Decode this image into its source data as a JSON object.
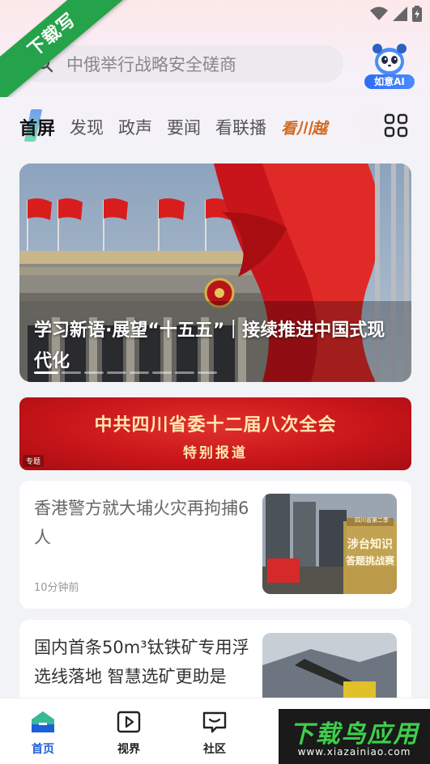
{
  "watermark": {
    "ribbon": "下载写",
    "badge_title": "下载鸟应用",
    "badge_url": "www.xiazainiao.com"
  },
  "search": {
    "placeholder": "中俄举行战略安全磋商",
    "ai_label": "如意AI"
  },
  "tabs": [
    {
      "label": "首屏",
      "active": true
    },
    {
      "label": "发现"
    },
    {
      "label": "政声"
    },
    {
      "label": "要闻"
    },
    {
      "label": "看联播"
    },
    {
      "label": "看川越"
    }
  ],
  "hero": {
    "title": "学习新语·展望“十五五”｜接续推进中国式现代化"
  },
  "special": {
    "line1": "中共四川省委十二届八次全会",
    "line2": "特别报道",
    "tag": "专题"
  },
  "news": [
    {
      "headline": "香港警方就大埔火灾再拘捕6人",
      "time": "10分钟前",
      "thumb_text_1": "涉台知识",
      "thumb_text_2": "答题挑战赛",
      "thumb_top": "四川省第二季"
    },
    {
      "headline": "国内首条50m³钛铁矿专用浮选线落地 智慧选矿更助是"
    }
  ],
  "bottom_nav": [
    {
      "label": "首页",
      "active": true
    },
    {
      "label": "视界"
    },
    {
      "label": "社区"
    }
  ],
  "colors": {
    "accent": "#1d5fd8",
    "ribbon": "#24a34a",
    "banner_red": "#c9161a"
  }
}
